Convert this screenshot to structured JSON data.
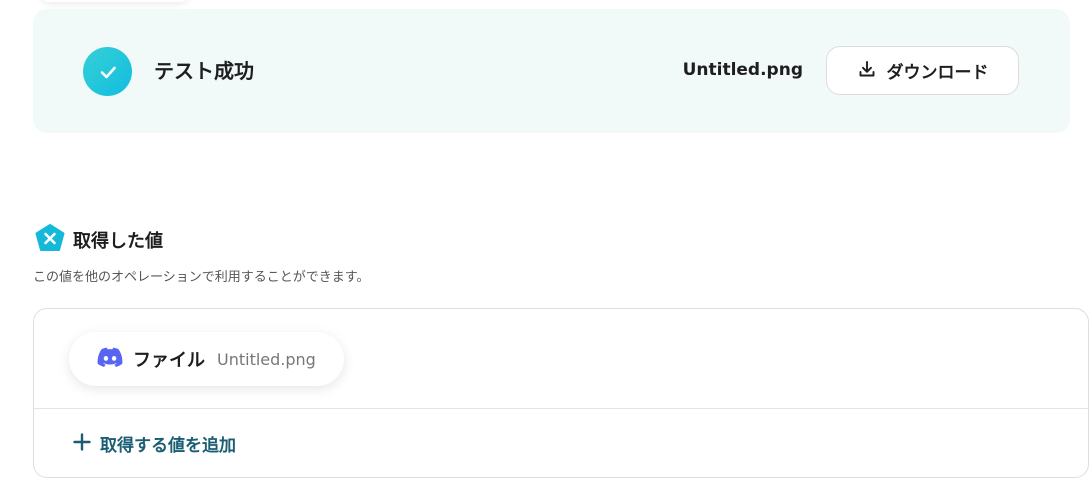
{
  "result": {
    "status_title": "テスト成功",
    "file_name": "Untitled.png",
    "download_label": "ダウンロード"
  },
  "retrieved": {
    "title": "取得した値",
    "description": "この値を他のオペレーションで利用することができます。",
    "items": [
      {
        "label": "ファイル",
        "value": "Untitled.png",
        "icon": "discord-icon"
      }
    ],
    "add_label": "取得する値を追加"
  },
  "colors": {
    "panel_bg": "#f1f9f9",
    "accent_cyan": "#12bde0",
    "discord": "#5865f2",
    "add_link": "#1b5e74"
  }
}
